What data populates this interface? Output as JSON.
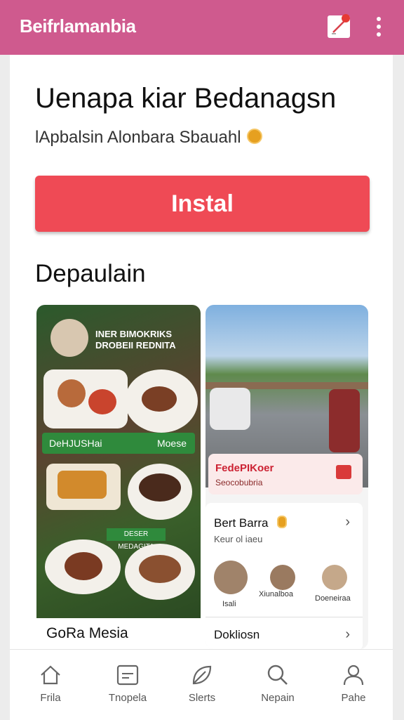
{
  "appbar": {
    "title": "Beifrlamanbia",
    "bg": "#cf5a8e",
    "icons": [
      "edit-icon",
      "more-vert-icon"
    ]
  },
  "app": {
    "name": "Uenapa kiar Bedanagsn",
    "developer": "lApbalsin Alonbara Sbauahl",
    "install_label": "Instal",
    "install_color": "#ef4a55"
  },
  "screenshots": {
    "section_title": "Depaulain",
    "shot1": {
      "promo_line1": "INER BIMOKRIKS",
      "promo_line2": "DROBEII REDNITA",
      "banner_left": "DeHJUSHai",
      "banner_right": "Moese",
      "sign": "DESER MEDAGITA",
      "caption": "GoRa Mesia"
    },
    "shot2": {
      "card_title": "FedePIKoer",
      "card_sub": "Seocobubria",
      "row_title": "Bert Barra",
      "row_sub": "Keur ol iaeu",
      "avatars": [
        "Isali",
        "Xiunalboa",
        "Doeneiraa"
      ],
      "row2": "Dokliosn"
    }
  },
  "nav": [
    {
      "label": "Frila",
      "icon": "home-icon"
    },
    {
      "label": "Tnopela",
      "icon": "list-icon"
    },
    {
      "label": "Slerts",
      "icon": "leaf-icon"
    },
    {
      "label": "Nepain",
      "icon": "search-icon"
    },
    {
      "label": "Pahe",
      "icon": "person-icon"
    }
  ]
}
